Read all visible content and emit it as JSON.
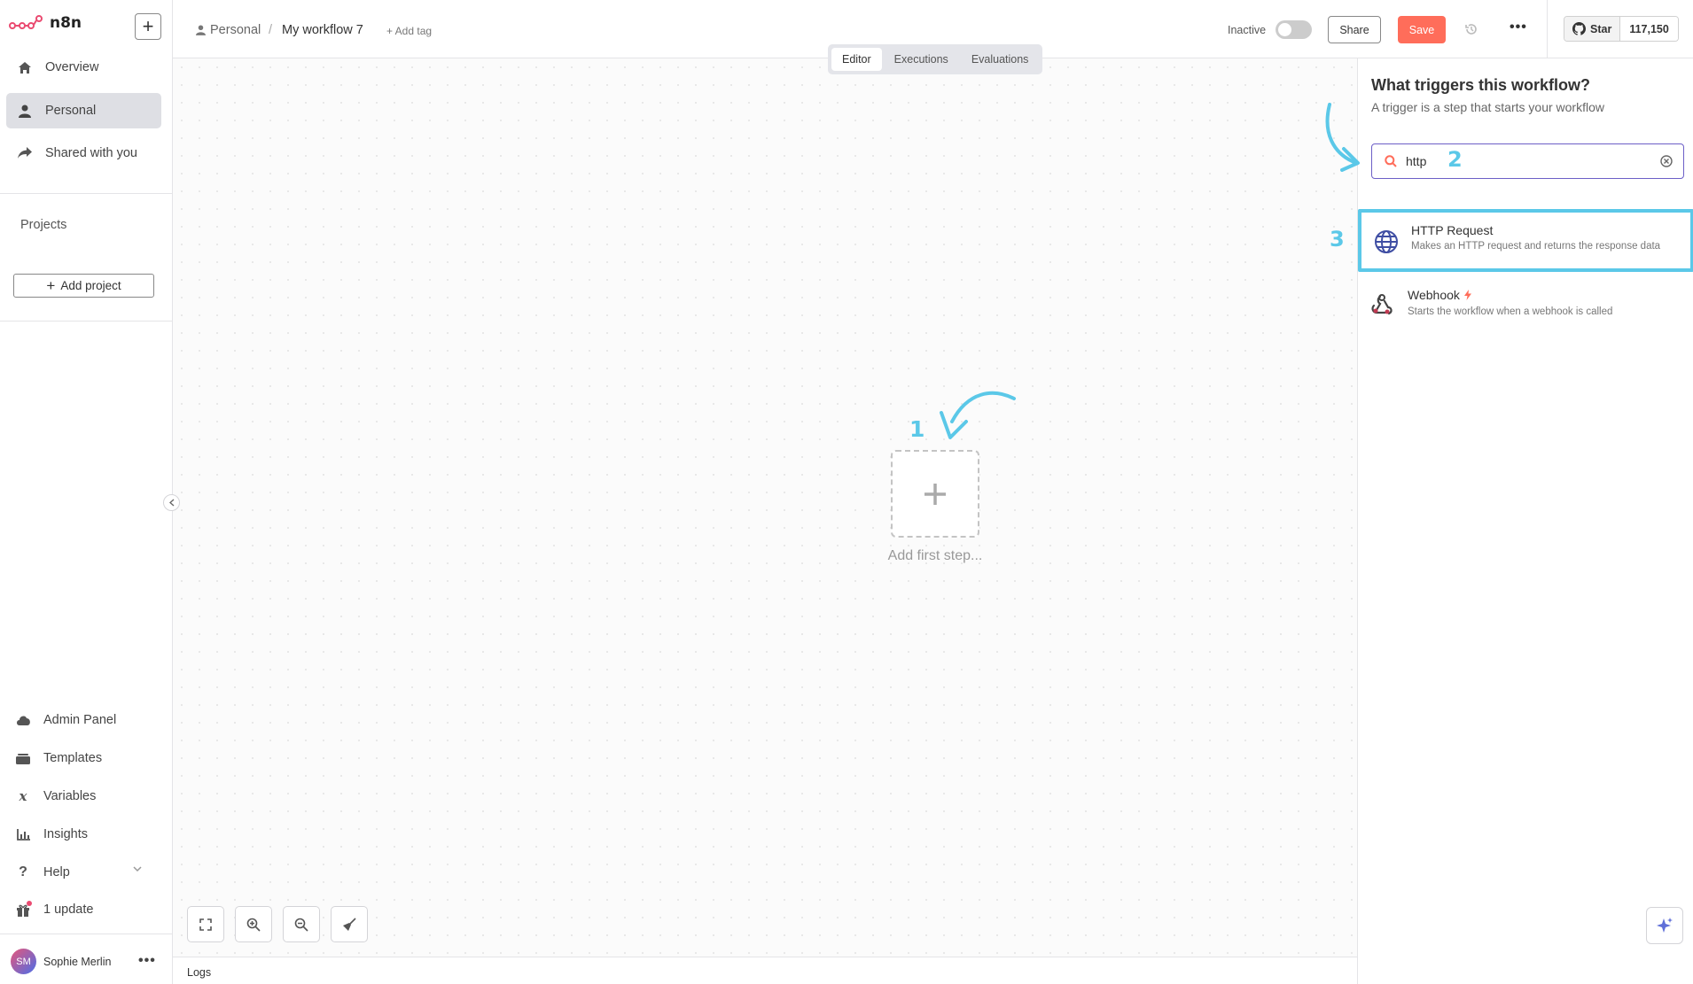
{
  "app": {
    "name": "n8n"
  },
  "sidebar": {
    "nav": [
      {
        "label": "Overview",
        "icon": "home-icon"
      },
      {
        "label": "Personal",
        "icon": "user-icon",
        "active": true
      },
      {
        "label": "Shared with you",
        "icon": "share-icon"
      }
    ],
    "projects_label": "Projects",
    "add_project_label": "Add project",
    "bottom": [
      {
        "label": "Admin Panel",
        "icon": "cloud-icon"
      },
      {
        "label": "Templates",
        "icon": "templates-icon"
      },
      {
        "label": "Variables",
        "icon": "variables-icon"
      },
      {
        "label": "Insights",
        "icon": "chart-icon"
      },
      {
        "label": "Help",
        "icon": "question-icon"
      },
      {
        "label": "1 update",
        "icon": "gift-icon"
      }
    ],
    "user": {
      "initials": "SM",
      "name": "Sophie Merlin"
    }
  },
  "header": {
    "breadcrumb_project": "Personal",
    "breadcrumb_separator": "/",
    "workflow_title": "My workflow 7",
    "add_tag": "+ Add tag",
    "status_label": "Inactive",
    "active": false,
    "share_label": "Share",
    "save_label": "Save",
    "github": {
      "star_label": "Star",
      "count": "117,150"
    }
  },
  "tabs": [
    {
      "label": "Editor",
      "active": true
    },
    {
      "label": "Executions"
    },
    {
      "label": "Evaluations"
    }
  ],
  "canvas": {
    "add_first_step": "Add first step...",
    "logs_label": "Logs"
  },
  "annotations": {
    "step1": "1",
    "step2": "2",
    "step3": "3",
    "color": "#5bc8e8"
  },
  "panel": {
    "title": "What triggers this workflow?",
    "subtitle": "A trigger is a step that starts your workflow",
    "search": {
      "value": "http"
    },
    "results": [
      {
        "name": "HTTP Request",
        "description": "Makes an HTTP request and returns the response data",
        "icon": "globe-icon",
        "highlighted": true
      },
      {
        "name": "Webhook",
        "description": "Starts the workflow when a webhook is called",
        "icon": "webhook-icon",
        "badge_icon": "bolt-icon"
      }
    ]
  },
  "colors": {
    "accent": "#ff6d5a",
    "search_border": "#6c5fc7",
    "highlight": "#5bc8e8"
  }
}
